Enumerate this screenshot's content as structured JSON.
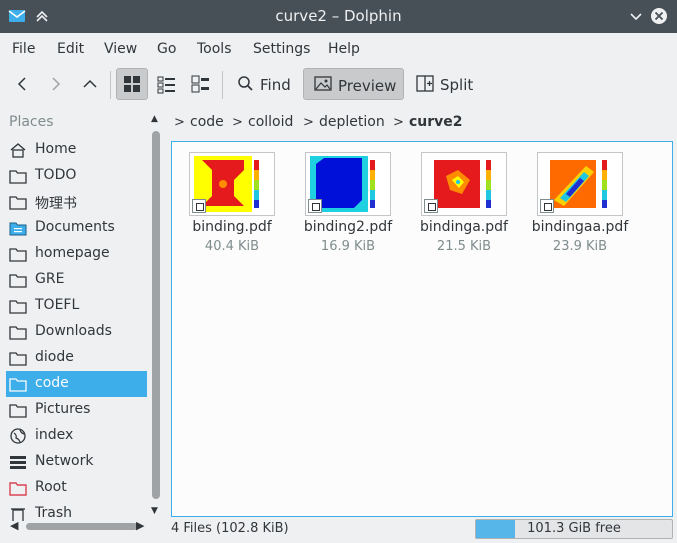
{
  "window": {
    "title": "curve2 – Dolphin"
  },
  "menu": [
    "File",
    "Edit",
    "View",
    "Go",
    "Tools",
    "Settings",
    "Help"
  ],
  "toolbar": {
    "find_label": "Find",
    "preview_label": "Preview",
    "split_label": "Split"
  },
  "places": {
    "header": "Places",
    "items": [
      {
        "label": "Home",
        "icon": "home-icon"
      },
      {
        "label": "TODO",
        "icon": "folder-icon"
      },
      {
        "label": "物理书",
        "icon": "folder-icon"
      },
      {
        "label": "Documents",
        "icon": "documents-folder-icon"
      },
      {
        "label": "homepage",
        "icon": "folder-icon"
      },
      {
        "label": "GRE",
        "icon": "folder-icon"
      },
      {
        "label": "TOEFL",
        "icon": "folder-icon"
      },
      {
        "label": "Downloads",
        "icon": "folder-icon"
      },
      {
        "label": "diode",
        "icon": "folder-icon"
      },
      {
        "label": "code",
        "icon": "folder-icon",
        "selected": true
      },
      {
        "label": "Pictures",
        "icon": "folder-icon"
      },
      {
        "label": "index",
        "icon": "globe-icon"
      },
      {
        "label": "Network",
        "icon": "network-icon"
      },
      {
        "label": "Root",
        "icon": "root-folder-icon"
      },
      {
        "label": "Trash",
        "icon": "trash-icon"
      }
    ]
  },
  "breadcrumb": [
    "code",
    "colloid",
    "depletion",
    "curve2"
  ],
  "files": [
    {
      "name": "binding.pdf",
      "size": "40.4 KiB",
      "thumb": "binding"
    },
    {
      "name": "binding2.pdf",
      "size": "16.9 KiB",
      "thumb": "binding2"
    },
    {
      "name": "bindinga.pdf",
      "size": "21.5 KiB",
      "thumb": "bindinga"
    },
    {
      "name": "bindingaa.pdf",
      "size": "23.9 KiB",
      "thumb": "bindingaa"
    }
  ],
  "status": {
    "summary": "4 Files (102.8 KiB)",
    "free_space": "101.3 GiB free",
    "used_fraction": 0.2
  },
  "colors": {
    "accent": "#3daee9",
    "titlebar": "#475057"
  }
}
